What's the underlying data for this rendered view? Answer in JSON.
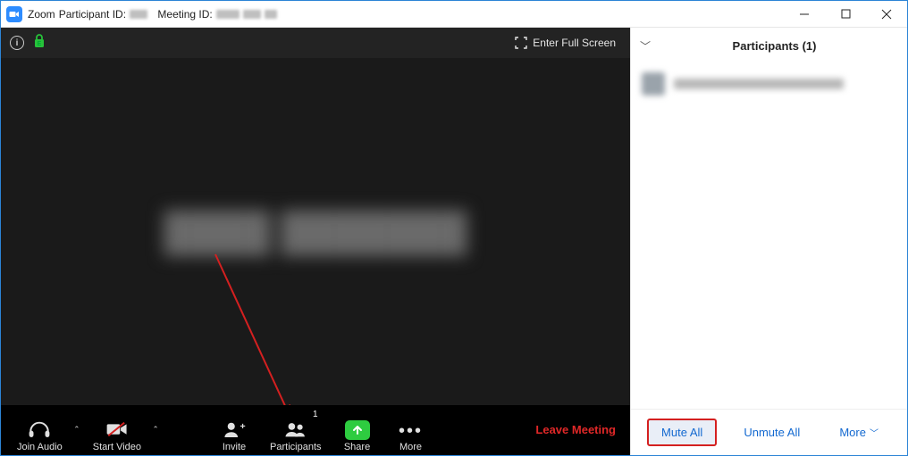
{
  "titlebar": {
    "app": "Zoom",
    "participant_label": "Participant ID:",
    "meeting_label": "Meeting ID:"
  },
  "video": {
    "fullscreen_label": "Enter Full Screen",
    "center_name_placeholder": "████ ███████"
  },
  "toolbar": {
    "join_audio": "Join Audio",
    "start_video": "Start Video",
    "invite": "Invite",
    "participants": "Participants",
    "participants_count": "1",
    "share": "Share",
    "more": "More",
    "leave": "Leave Meeting"
  },
  "panel": {
    "title": "Participants (1)",
    "mute_all": "Mute All",
    "unmute_all": "Unmute All",
    "more": "More"
  }
}
